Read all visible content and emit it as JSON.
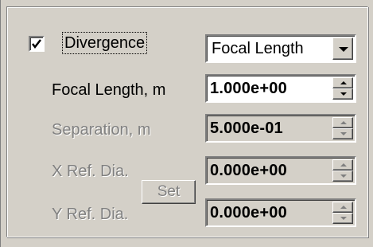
{
  "divergence": {
    "checkbox_label": "Divergence",
    "checked": true
  },
  "mode_combo": {
    "selected": "Focal Length"
  },
  "fields": [
    {
      "label": "Focal Length, m",
      "value": "1.000e+00",
      "enabled": true
    },
    {
      "label": "Separation, m",
      "value": "5.000e-01",
      "enabled": false
    },
    {
      "label": "X Ref. Dia.",
      "value": "0.000e+00",
      "enabled": false
    },
    {
      "label": "Y Ref. Dia.",
      "value": "0.000e+00",
      "enabled": false
    }
  ],
  "set_button": {
    "label": "Set",
    "enabled": false
  },
  "icons": {
    "checkmark": "checkmark-icon",
    "combo_arrow": "chevron-down-icon",
    "spin_up": "spin-up-icon",
    "spin_down": "spin-down-icon"
  },
  "colors": {
    "face": "#d4d0c8",
    "shadow": "#808080",
    "highlight": "#ffffff",
    "disabled_text": "#808080"
  }
}
